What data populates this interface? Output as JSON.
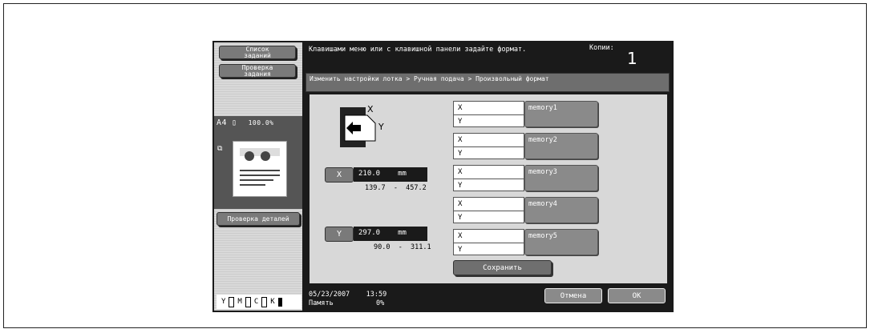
{
  "sidebar": {
    "job_list_label": "Список заданий",
    "job_check_label": "Проверка задания",
    "paper_info": "A4",
    "zoom": "100.0%",
    "details_button": "Проверка деталей",
    "toner": [
      "Y",
      "M",
      "C",
      "K"
    ]
  },
  "header": {
    "message": "Клавишами меню или с клавишной панели задайте формат.",
    "copies_label": "Копии:",
    "copies_value": "1"
  },
  "breadcrumb": "Изменить настройки лотка > Ручная подача > Произвольный формат",
  "dimensions": {
    "x": {
      "label": "X",
      "value": "210.0",
      "unit": "mm",
      "range": "139.7  -  457.2"
    },
    "y": {
      "label": "Y",
      "value": "297.0",
      "unit": "mm",
      "range": "90.0  -  311.1"
    }
  },
  "memories": [
    {
      "label": "memory1",
      "x_label": "X",
      "y_label": "Y"
    },
    {
      "label": "memory2",
      "x_label": "X",
      "y_label": "Y"
    },
    {
      "label": "memory3",
      "x_label": "X",
      "y_label": "Y"
    },
    {
      "label": "memory4",
      "x_label": "X",
      "y_label": "Y"
    },
    {
      "label": "memory5",
      "x_label": "X",
      "y_label": "Y"
    }
  ],
  "save_button": "Сохранить",
  "footer": {
    "datetime": "05/23/2007    13:59",
    "memory_label": "Память",
    "memory_value": "0%",
    "cancel_button": "Отмена",
    "ok_button": "OK"
  }
}
